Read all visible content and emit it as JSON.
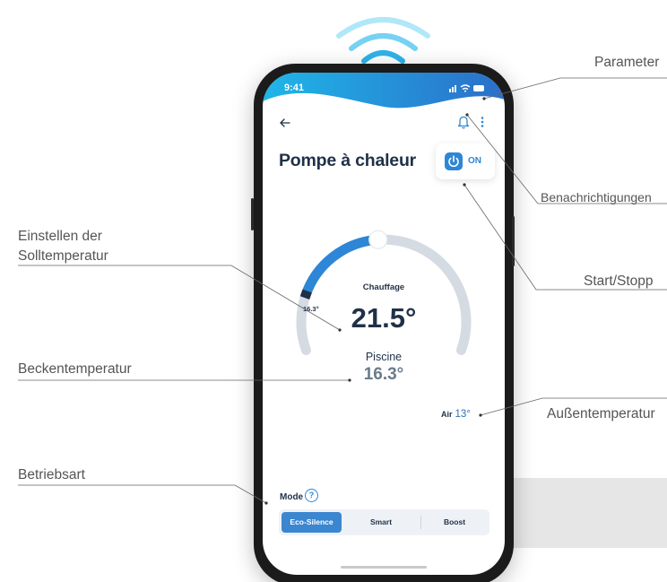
{
  "annotations": {
    "parameter": "Parameter",
    "notifications": "Benachrichtigungen",
    "start_stop": "Start/Stopp",
    "outdoor_temp": "Außentemperatur",
    "set_temp_line1": "Einstellen der",
    "set_temp_line2": "Solltemperatur",
    "pool_temp": "Beckentemperatur",
    "operating_mode": "Betriebsart"
  },
  "status_bar": {
    "time": "9:41"
  },
  "app": {
    "title": "Pompe à chaleur",
    "power": {
      "state": "ON"
    }
  },
  "gauge": {
    "mode": "Chauffage",
    "min_label": "16.3°",
    "setpoint": "21.5°",
    "pool_label": "Piscine",
    "pool_temp": "16.3°",
    "setpoint_fraction": 0.55
  },
  "air": {
    "label": "Air",
    "value": "13°"
  },
  "mode": {
    "label": "Mode",
    "help": "?",
    "options": [
      "Eco-Silence",
      "Smart",
      "Boost"
    ],
    "selected": "Eco-Silence"
  },
  "colors": {
    "accent": "#2e86d6",
    "header_gradient_start": "#1fb6e8",
    "header_gradient_end": "#2b6fc9",
    "text_dark": "#1f3148",
    "track": "#d5dbe2"
  },
  "icons": [
    "wifi-signal-icon",
    "back-arrow-icon",
    "bell-icon",
    "more-vertical-icon",
    "power-icon",
    "help-circle-icon"
  ]
}
